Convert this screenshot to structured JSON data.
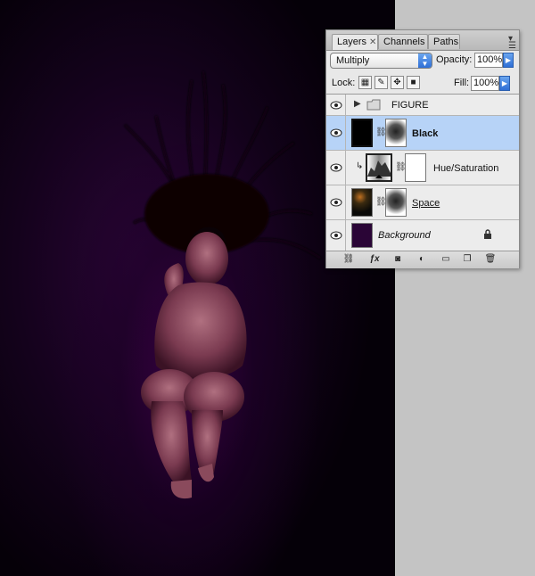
{
  "panel": {
    "tabs": [
      {
        "label": "Layers",
        "active": true
      },
      {
        "label": "Channels",
        "active": false
      },
      {
        "label": "Paths",
        "active": false
      }
    ],
    "blend_mode": "Multiply",
    "opacity_label": "Opacity:",
    "opacity_value": "100%",
    "lock_label": "Lock:",
    "fill_label": "Fill:",
    "fill_value": "100%",
    "layers": [
      {
        "name": "FIGURE",
        "type": "group"
      },
      {
        "name": "Black",
        "type": "masked",
        "selected": true
      },
      {
        "name": "Hue/Saturation",
        "type": "adjustment"
      },
      {
        "name": "Space",
        "type": "masked"
      },
      {
        "name": "Background",
        "type": "background",
        "locked": true
      }
    ]
  },
  "colors": {
    "selection_blue": "#b7d3f7",
    "accent_blue": "#2f6fd6",
    "canvas_purple": "#2a0536"
  }
}
